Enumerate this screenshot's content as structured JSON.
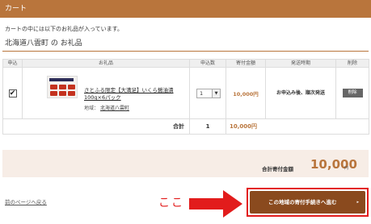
{
  "header": {
    "title": "カート"
  },
  "intro": {
    "text": "カートの中には以下のお礼品が入っています。"
  },
  "region": {
    "title": "北海道八雲町 の お礼品"
  },
  "table": {
    "headers": [
      "申込",
      "お礼品",
      "申込数",
      "寄付金額",
      "発送時期",
      "削除"
    ],
    "item": {
      "checked": "✔",
      "name": "さとふる限定【大満足】いくら醤油漬100g×6パック",
      "region_label": "地域：",
      "region_link": "北海道八雲町",
      "quantity": "1",
      "amount": "10,000円",
      "shipping": "お申込み後、順次発送",
      "delete_label": "削除"
    },
    "total": {
      "label": "合計",
      "quantity": "1",
      "amount": "10,000円"
    }
  },
  "summary": {
    "label": "合計寄付金額",
    "value": "10,000",
    "unit": "円"
  },
  "footer": {
    "back_link": "前のページへ戻る",
    "annotation": "ここ",
    "proceed_label": "この地域の寄付手続きへ進む",
    "proceed_icon": "▸"
  },
  "colors": {
    "brand": "#b9753c",
    "button": "#8a4a1e",
    "highlight": "#e21c1c",
    "summary_bg": "#f7ede6"
  }
}
